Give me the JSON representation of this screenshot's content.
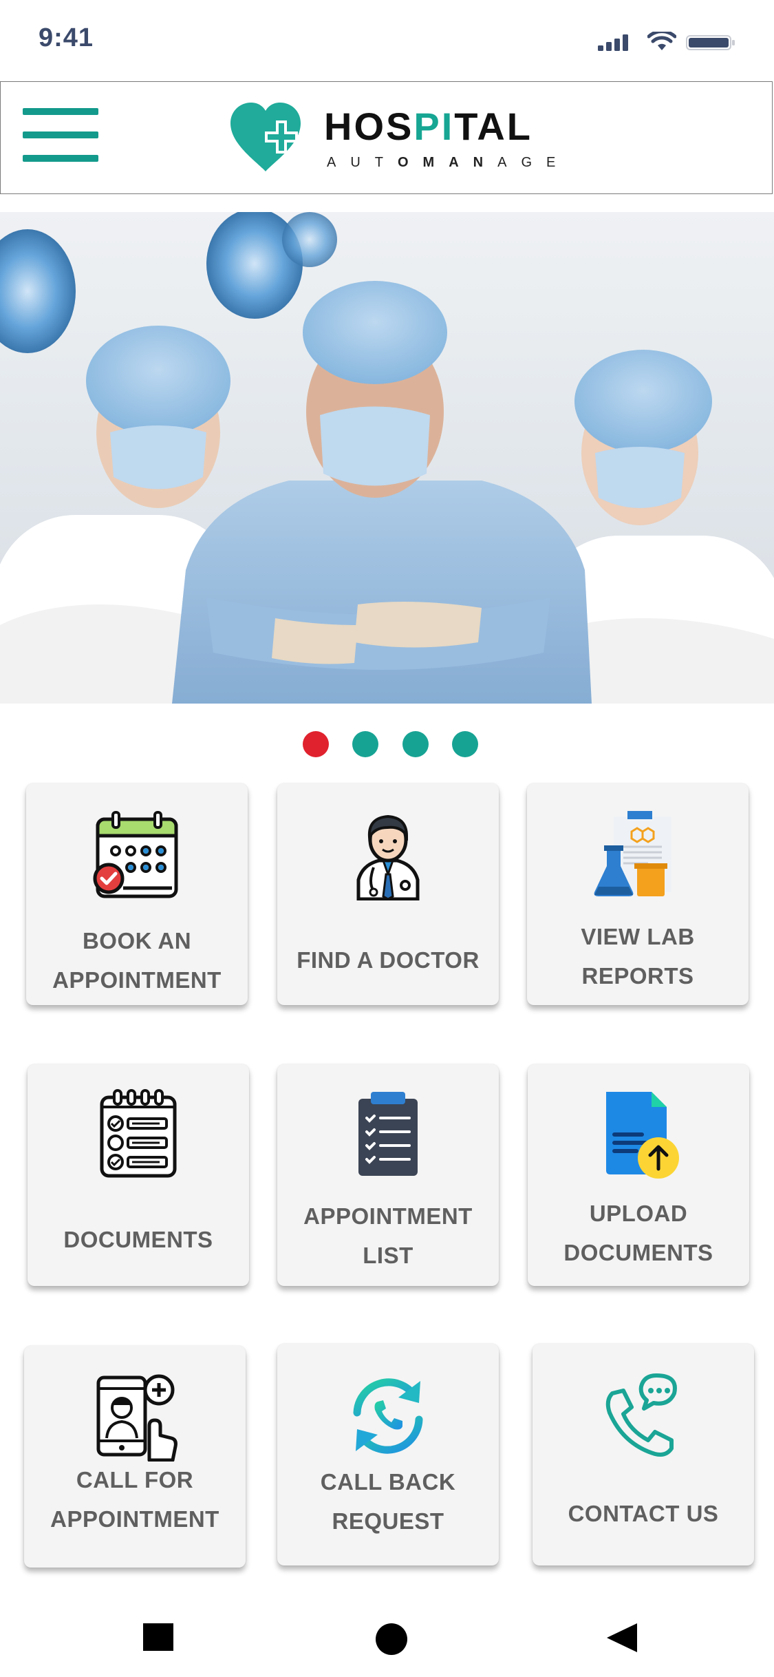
{
  "status_bar": {
    "time": "9:41"
  },
  "header": {
    "logo_title_pre": "HOS",
    "logo_title_accent": "PI",
    "logo_title_post": "TAL",
    "logo_sub_pre": "AUT",
    "logo_sub_bold": "OMAN",
    "logo_sub_post": "AGE",
    "menu_icon": "hamburger-menu-icon",
    "logo_icon": "heart-cross-icon"
  },
  "carousel": {
    "image": "medical-team-photo",
    "slides": [
      {
        "active": true
      },
      {
        "active": false
      },
      {
        "active": false
      },
      {
        "active": false
      }
    ],
    "active_color": "#e0222e",
    "inactive_color": "#17a394"
  },
  "tiles": [
    {
      "line1": "BOOK AN",
      "line2": "APPOINTMENT",
      "icon": "calendar-icon"
    },
    {
      "line1": "FIND A DOCTOR",
      "line2": "",
      "icon": "doctor-icon"
    },
    {
      "line1": "VIEW LAB",
      "line2": "REPORTS",
      "icon": "lab-flask-icon"
    },
    {
      "line1": "DOCUMENTS",
      "line2": "",
      "icon": "checklist-icon"
    },
    {
      "line1": "APPOINTMENT",
      "line2": "LIST",
      "icon": "clipboard-icon"
    },
    {
      "line1": "UPLOAD",
      "line2": "DOCUMENTS",
      "icon": "upload-file-icon"
    },
    {
      "line1": "CALL FOR",
      "line2": "APPOINTMENT",
      "icon": "phone-doctor-icon"
    },
    {
      "line1": "CALL BACK",
      "line2": "REQUEST",
      "icon": "callback-icon"
    },
    {
      "line1": "CONTACT US",
      "line2": "",
      "icon": "phone-chat-icon"
    }
  ],
  "nav": {
    "recents_icon": "square-icon",
    "home_icon": "circle-icon",
    "back_icon": "triangle-back-icon"
  },
  "colors": {
    "brand_teal": "#16a693",
    "label_gray": "#5f5f5f",
    "tile_bg": "#f4f4f4"
  }
}
